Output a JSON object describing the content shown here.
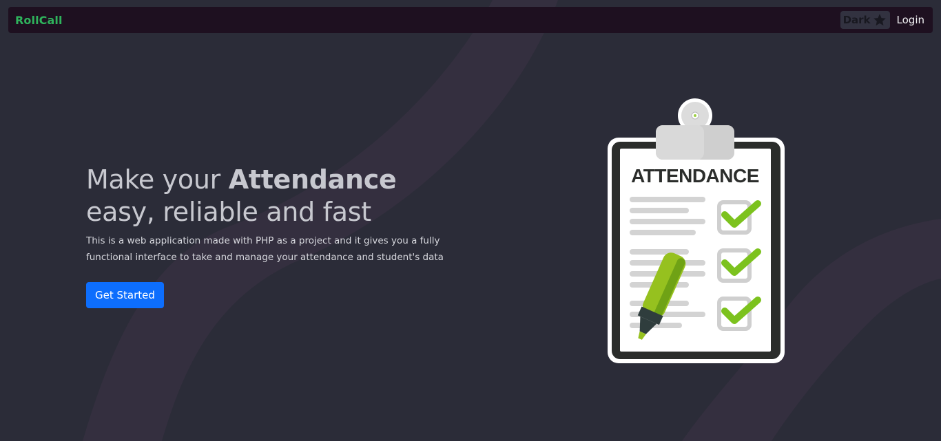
{
  "navbar": {
    "brand": "RollCall",
    "theme_toggle_label": "Dark",
    "theme_toggle_icon": "star-icon",
    "login_label": "Login"
  },
  "hero": {
    "title_part1": "Make your ",
    "title_bold": "Attendance",
    "title_line2": "easy, reliable and fast",
    "description": "This is a web application made with PHP as a project and it gives you a fully functional interface to take and manage your attendance and student's data",
    "cta_label": "Get Started"
  },
  "illustration": {
    "heading": "ATTENDANCE",
    "icon": "clipboard-checklist-icon",
    "checked_items": 3
  },
  "colors": {
    "background": "#2b2c38",
    "navbar_bg": "#1e1020",
    "brand": "#2fb35c",
    "primary_button": "#0d6efd",
    "check_green": "#7cc21e",
    "marker_green": "#96c11f"
  }
}
